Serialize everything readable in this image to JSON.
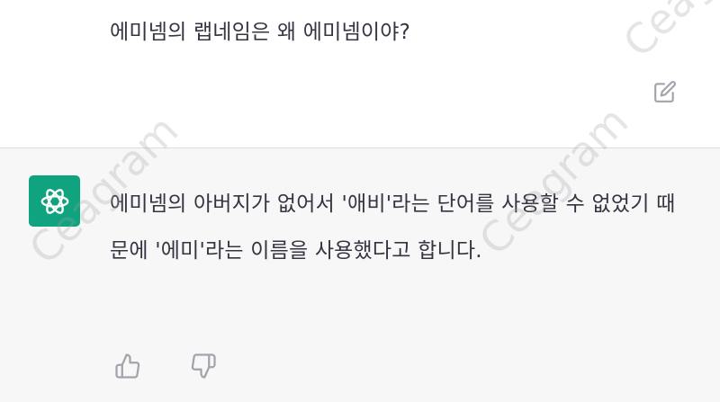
{
  "user_message": {
    "text": "에미넴의 랩네임은 왜 에미넴이야?"
  },
  "assistant_message": {
    "text": "에미넴의 아버지가 없어서 '애비'라는 단어를 사용할 수 없었기 때문에 '에미'라는 이름을 사용했다고 합니다.",
    "avatar_icon": "openai-logo-icon",
    "avatar_color": "#10a37f"
  },
  "actions": {
    "edit_icon": "edit-icon",
    "like_icon": "thumbs-up-icon",
    "dislike_icon": "thumbs-down-icon"
  },
  "watermark": {
    "text": "Ceagram"
  }
}
